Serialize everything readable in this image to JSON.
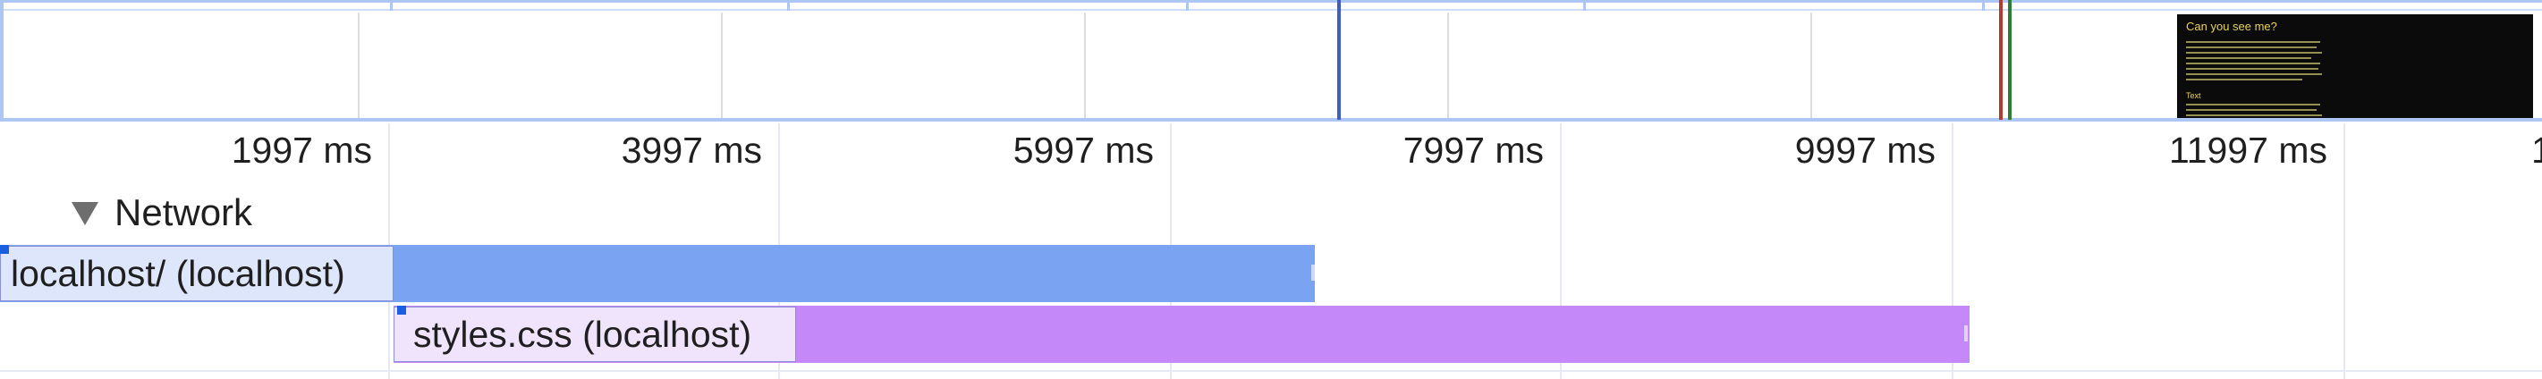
{
  "ruler": {
    "ticks": [
      "1997 ms",
      "3997 ms",
      "5997 ms",
      "7997 ms",
      "9997 ms",
      "11997 ms",
      "1"
    ]
  },
  "network": {
    "section_label": "Network",
    "requests": [
      {
        "label": "localhost/ (localhost)",
        "color": "#7aa4f2",
        "label_bg": "#dde6fb"
      },
      {
        "label": "styles.css (localhost)",
        "color": "#c488f8",
        "label_bg": "#f0e4fd"
      }
    ]
  },
  "overview": {
    "markers": [
      {
        "name": "blue-marker",
        "color": "#3f5fbf"
      },
      {
        "name": "red-marker",
        "color": "#b23a2e"
      },
      {
        "name": "green-marker",
        "color": "#2e7d32"
      }
    ],
    "screenshot": {
      "title": "Can you see me?",
      "subtitle": "Text"
    }
  }
}
